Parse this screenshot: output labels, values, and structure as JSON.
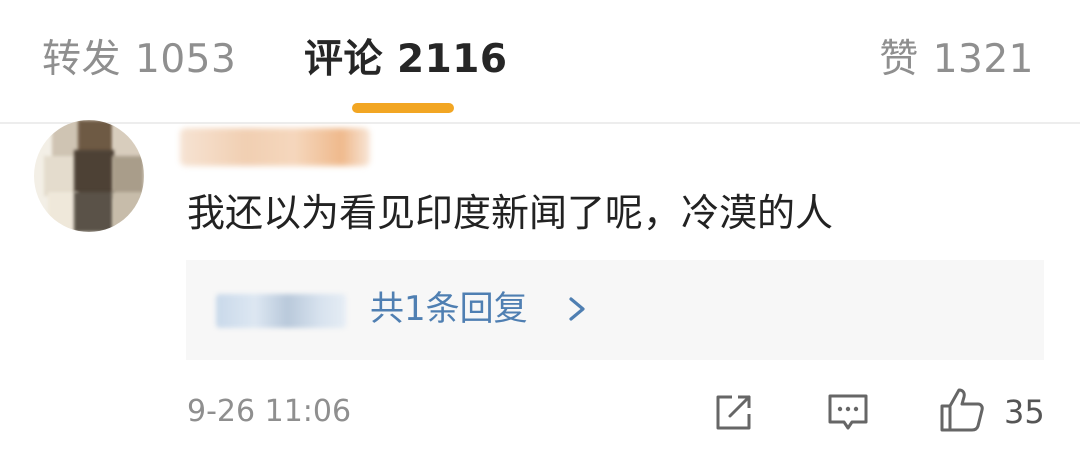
{
  "tabs": {
    "repost": {
      "label": "转发",
      "count": "1053"
    },
    "comments": {
      "label": "评论",
      "count": "2116"
    },
    "likes": {
      "label": "赞",
      "count": "1321"
    }
  },
  "comment": {
    "text": "我还以为看见印度新闻了呢，冷漠的人",
    "replies_label": "共1条回复",
    "timestamp": "9-26 11:06",
    "like_count": "35"
  },
  "icons": {
    "share": "share-icon",
    "reply": "comment-icon",
    "like": "thumbs-up-icon",
    "expand": "chevron-right-icon"
  },
  "colors": {
    "active_tab_underline": "#f2a623",
    "link": "#4f7fb2",
    "muted_text": "#8f8f8f",
    "primary_text": "#222222"
  }
}
